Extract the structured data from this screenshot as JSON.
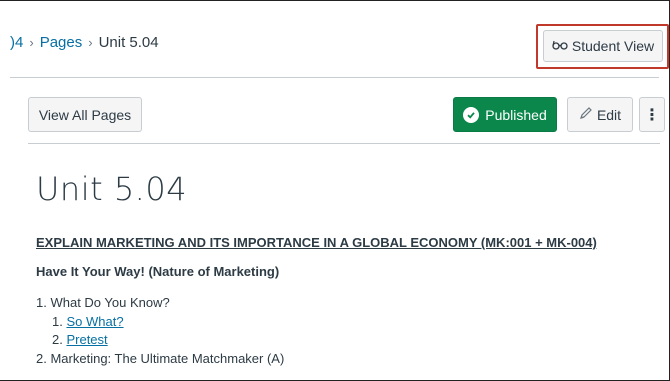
{
  "breadcrumb": {
    "course_fragment": ")4",
    "pages_label": "Pages",
    "current": "Unit 5.04",
    "separator": "›"
  },
  "header": {
    "student_view_label": "Student View",
    "student_view_icon": "glasses-icon"
  },
  "toolbar": {
    "view_all_label": "View All Pages",
    "published_label": "Published",
    "published_color": "#0b874b",
    "edit_label": "Edit",
    "more_label": "⋮"
  },
  "content": {
    "title": "Unit 5.04",
    "objective": "EXPLAIN MARKETING AND ITS IMPORTANCE IN A GLOBAL ECONOMY (MK:001 + MK-004)",
    "subheading": "Have It Your Way! (Nature of Marketing)",
    "outline": [
      {
        "number": "1.",
        "text": "What Do You Know?"
      },
      {
        "number": "1.",
        "text": "So What?"
      },
      {
        "number": "2.",
        "text": "Pretest"
      },
      {
        "number": "2.",
        "text": "Marketing: The Ultimate Matchmaker (A)"
      }
    ]
  },
  "colors": {
    "link": "#0770a3",
    "text": "#2d3b45",
    "highlight": "#c0392b"
  }
}
